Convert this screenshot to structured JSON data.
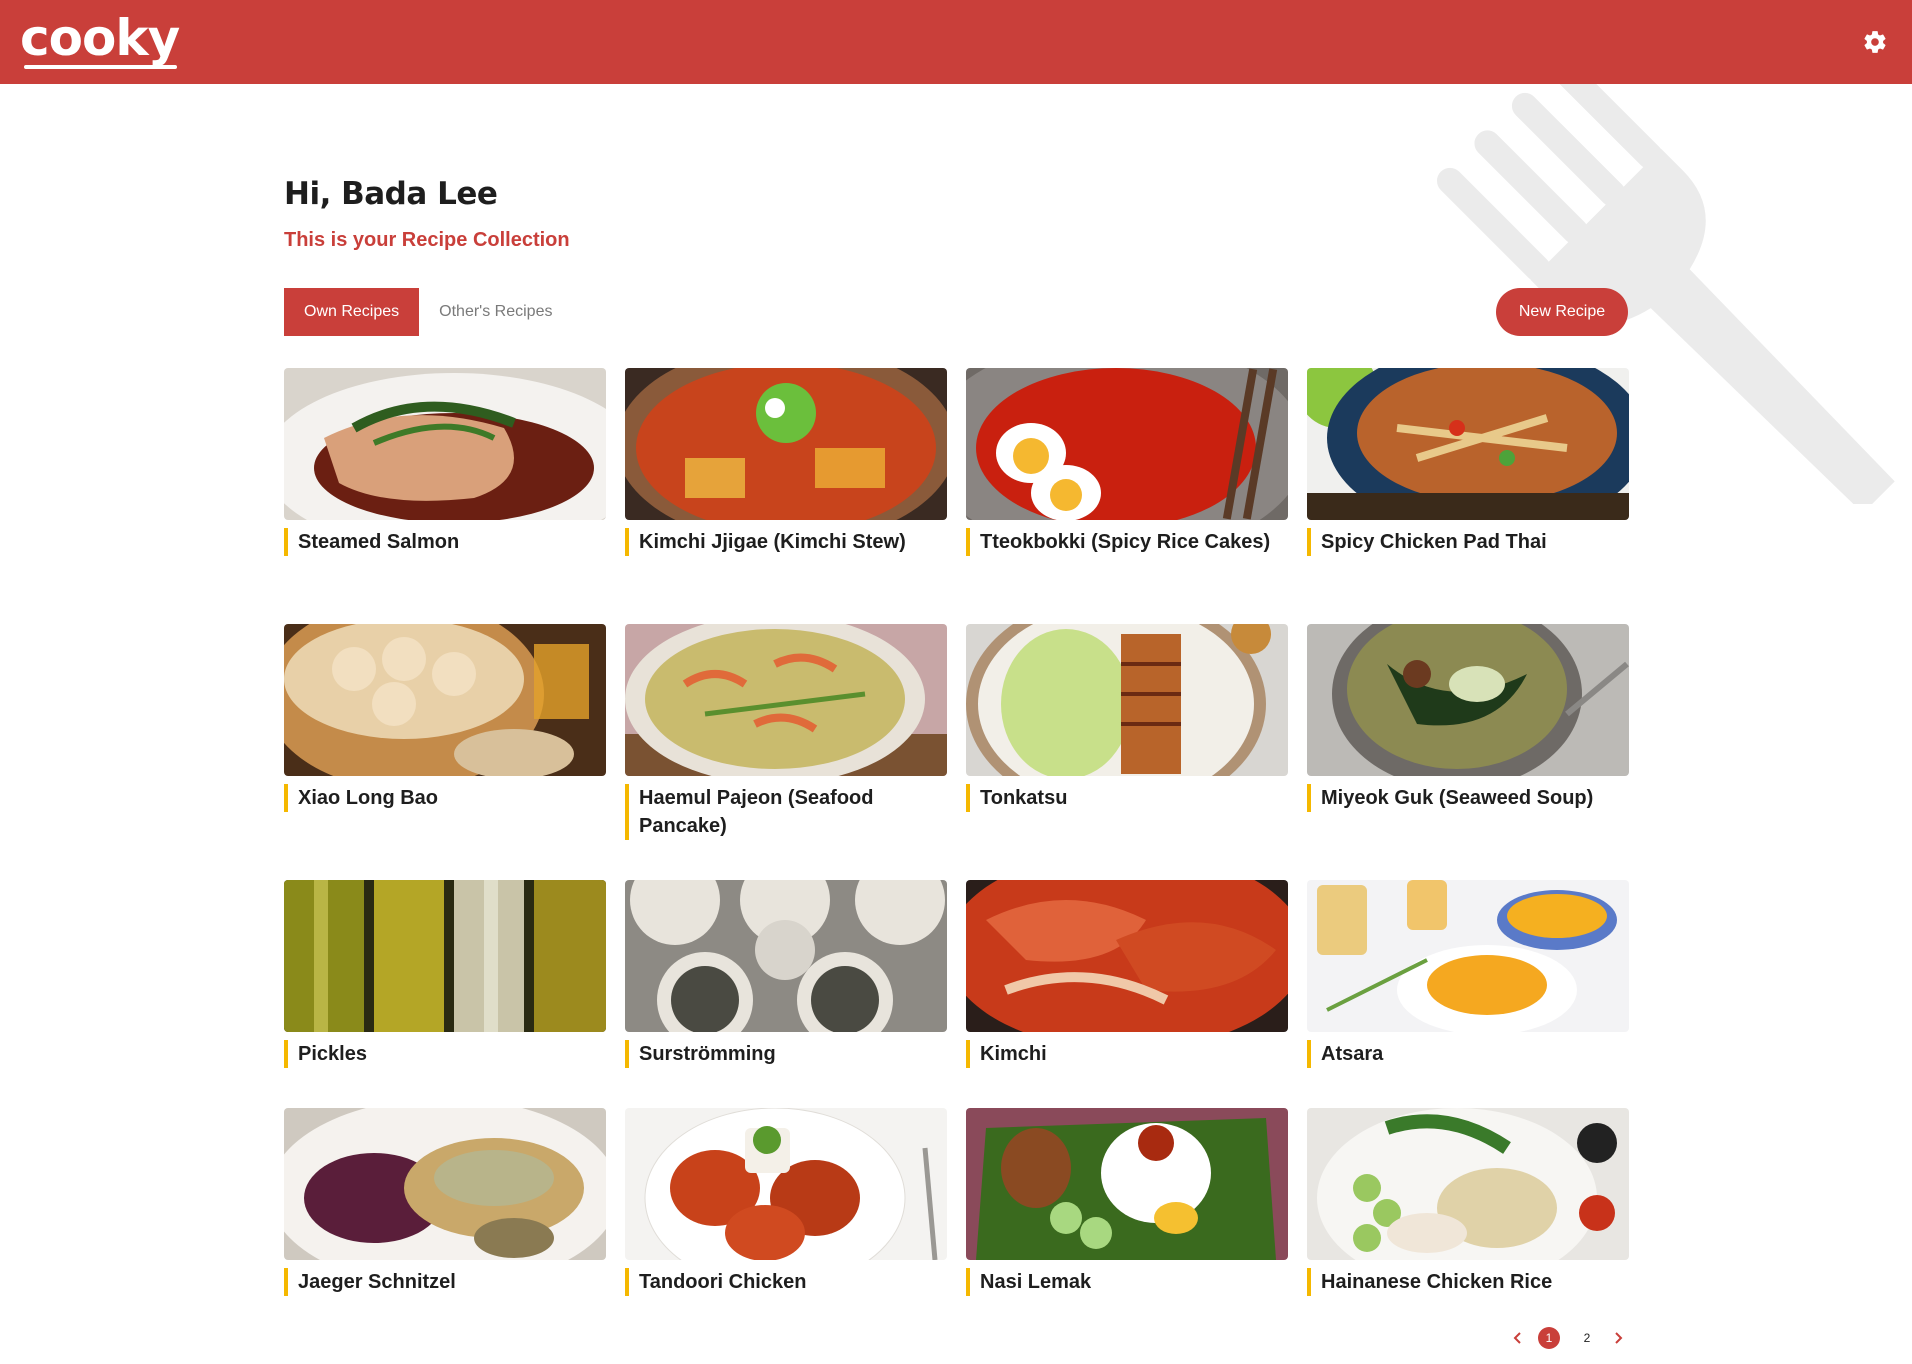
{
  "app": {
    "logo_text": "cooky"
  },
  "header": {
    "settings_icon": "gear-icon"
  },
  "greeting": "Hi, Bada Lee",
  "subtitle": "This is your Recipe Collection",
  "tabs": [
    {
      "label": "Own Recipes",
      "active": true
    },
    {
      "label": "Other's Recipes",
      "active": false
    }
  ],
  "new_recipe_label": "New Recipe",
  "recipes": [
    {
      "title": "Steamed Salmon"
    },
    {
      "title": "Kimchi Jjigae (Kimchi Stew)"
    },
    {
      "title": "Tteokbokki (Spicy Rice Cakes)"
    },
    {
      "title": "Spicy Chicken Pad Thai"
    },
    {
      "title": "Xiao Long Bao"
    },
    {
      "title": "Haemul Pajeon (Seafood Pancake)"
    },
    {
      "title": "Tonkatsu"
    },
    {
      "title": "Miyeok Guk (Seaweed Soup)"
    },
    {
      "title": "Pickles"
    },
    {
      "title": "Surströmming"
    },
    {
      "title": "Kimchi"
    },
    {
      "title": "Atsara"
    },
    {
      "title": "Jaeger Schnitzel"
    },
    {
      "title": "Tandoori Chicken"
    },
    {
      "title": "Nasi Lemak"
    },
    {
      "title": "Hainanese Chicken Rice"
    }
  ],
  "pagination": {
    "pages": [
      "1",
      "2"
    ],
    "current": "1"
  },
  "colors": {
    "brand": "#c93f3a",
    "accent": "#f5b800"
  }
}
